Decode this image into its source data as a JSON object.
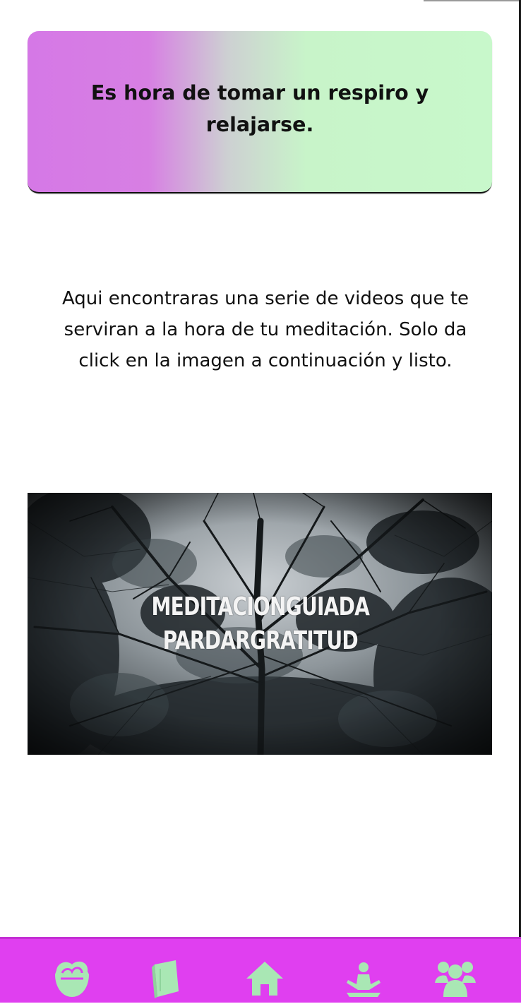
{
  "banner": {
    "text": "Es hora de tomar un respiro y relajarse."
  },
  "intro": {
    "text": "Aqui encontraras una serie de videos que te serviran a la hora de tu meditación. Solo da click en la imagen a continuación y listo."
  },
  "video": {
    "title_line1": "MEDITACIONGUIADA",
    "title_line2": "PARDARGRATITUD"
  },
  "tabbar": {
    "background": "#e03ff0",
    "icon_color": "#a9e7b4",
    "tabs": [
      {
        "icon": "nutrition-bowl-icon"
      },
      {
        "icon": "book-icon"
      },
      {
        "icon": "home-icon"
      },
      {
        "icon": "meditation-icon"
      },
      {
        "icon": "community-icon"
      }
    ]
  }
}
